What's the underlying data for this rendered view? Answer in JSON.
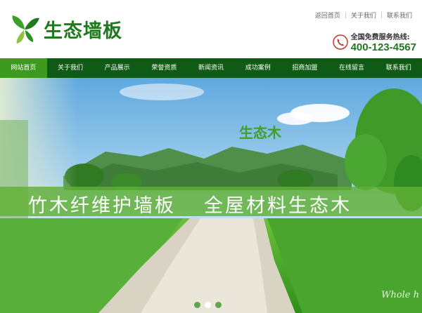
{
  "logo": {
    "text": "生态墙板",
    "icon": "leaf-logo-icon",
    "brand_color": "#1f7a1f"
  },
  "toplinks": [
    {
      "label": "返回首页"
    },
    {
      "label": "关于我们"
    },
    {
      "label": "联系我们"
    }
  ],
  "hotline": {
    "label": "全国免费服务热线:",
    "number": "400-123-4567",
    "icon": "phone-icon"
  },
  "nav": {
    "bg_color": "#0f5a14",
    "active_color": "#3c9a1e",
    "items": [
      {
        "label": "网站首页"
      },
      {
        "label": "关于我们"
      },
      {
        "label": "产品展示"
      },
      {
        "label": "荣誉资质"
      },
      {
        "label": "新闻资讯"
      },
      {
        "label": "成功案例"
      },
      {
        "label": "招商加盟"
      },
      {
        "label": "在线留言"
      },
      {
        "label": "联系我们"
      }
    ]
  },
  "banner": {
    "brand_tag": "生态木",
    "slogan_left": "竹木纤维护墙板",
    "slogan_right": "全屋材料生态木",
    "watermark": "Whole h",
    "slides": 3,
    "active_slide": 2
  }
}
